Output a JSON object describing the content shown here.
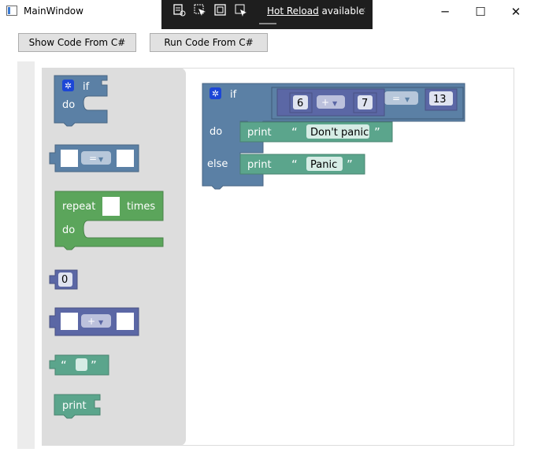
{
  "window": {
    "title": "MainWindow",
    "minimize": "─",
    "maximize": "☐",
    "close": "✕"
  },
  "hot_reload": {
    "link": "Hot Reload",
    "suffix": "available"
  },
  "toolbar": {
    "show_code_label": "Show Code From C#",
    "run_code_label": "Run Code From C#"
  },
  "toolbox": {
    "if_block": {
      "if_label": "if",
      "do_label": "do"
    },
    "compare_block": {
      "operator": "="
    },
    "repeat_block": {
      "repeat_label": "repeat",
      "times_label": "times",
      "do_label": "do"
    },
    "number_block": {
      "value": "0"
    },
    "arith_block": {
      "operator": "+"
    },
    "text_block": {
      "open_quote": "“",
      "close_quote": "”"
    },
    "print_block": {
      "label": "print"
    }
  },
  "workspace": {
    "if_label": "if",
    "do_label": "do",
    "else_label": "else",
    "left_number": "6",
    "arith_operator": "+",
    "right_number": "7",
    "compare_operator": "=",
    "compare_value": "13",
    "do_print_label": "print",
    "do_text": "Don't panic",
    "else_print_label": "print",
    "else_text": "Panic",
    "open_quote": "“",
    "close_quote": "”"
  },
  "colors": {
    "logic": "#5b80a5",
    "math": "#5b67a5",
    "loop": "#5ba55b",
    "text": "#5ba58c",
    "flyout": "#dddddd",
    "hot_reload_bar": "#1e1e1e"
  }
}
